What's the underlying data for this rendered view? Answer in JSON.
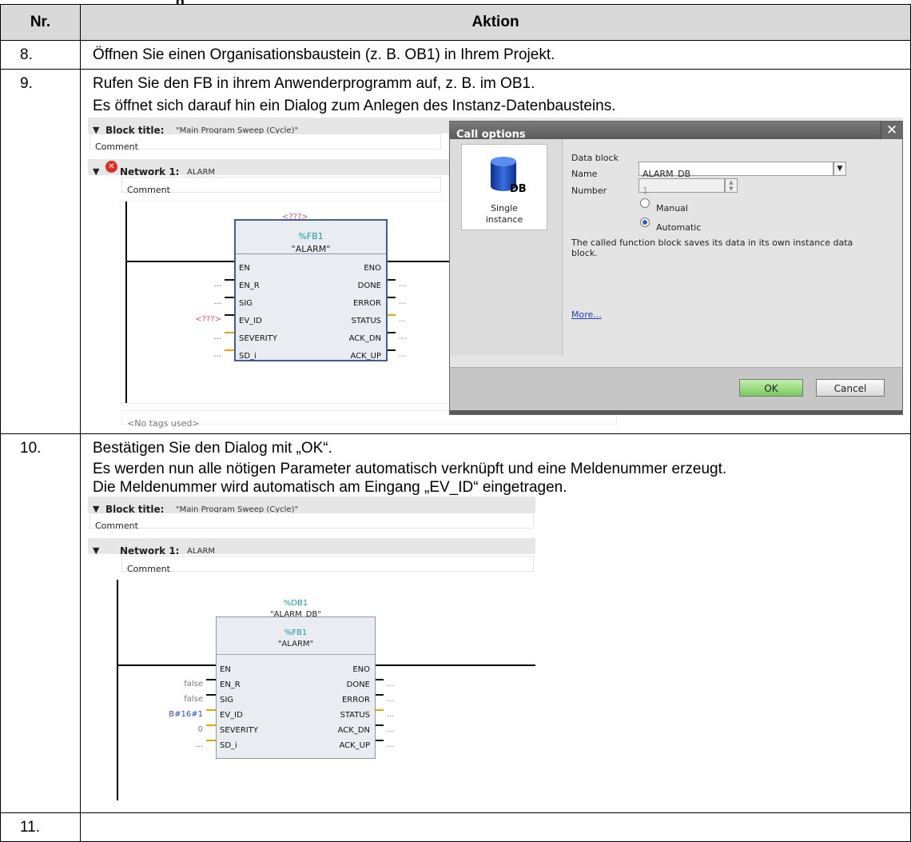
{
  "table": {
    "header_overflow": "g",
    "col_nr": "Nr.",
    "col_action": "Aktion"
  },
  "rows": [
    {
      "nr": "8.",
      "lines": [
        "Öffnen Sie einen Organisationsbaustein (z. B. OB1) in Ihrem Projekt."
      ]
    },
    {
      "nr": "9.",
      "lines": [
        "Rufen Sie den FB in ihrem Anwenderprogramm auf, z. B. im OB1.",
        "Es öffnet sich darauf hin ein Dialog zum Anlegen des Instanz-Datenbausteins."
      ]
    },
    {
      "nr": "10.",
      "lines": [
        "Bestätigen Sie den Dialog mit „OK“.",
        "Es werden nun alle nötigen Parameter automatisch verknüpft und eine Meldenummer erzeugt.",
        "Die Meldenummer wird automatisch am Eingang „EV_ID“ eingetragen."
      ]
    },
    {
      "nr": "11.",
      "lines": []
    }
  ],
  "shot1": {
    "block_title_label": "Block title:",
    "block_title_value": "\"Main Program Sweep (Cycle)\"",
    "comment": "Comment",
    "network_label": "Network 1:",
    "network_name": "ALARM",
    "network_comment": "Comment",
    "instance_placeholder": "<???>",
    "fb_address": "%FB1",
    "fb_name": "\"ALARM\"",
    "inputs": [
      "EN",
      "EN_R",
      "SIG",
      "EV_ID",
      "SEVERITY",
      "SD_i"
    ],
    "outputs": [
      "ENO",
      "DONE",
      "ERROR",
      "STATUS",
      "ACK_DN",
      "ACK_UP"
    ],
    "input_values": [
      "",
      "...",
      "...",
      "<???>",
      "...",
      "..."
    ],
    "output_values": [
      "",
      "...",
      "...",
      "...",
      "...",
      "..."
    ],
    "no_tags": "<No tags used>"
  },
  "dialog": {
    "title": "Call options",
    "close": "✕",
    "instance_label_1": "Single",
    "instance_label_2": "instance",
    "db_badge": "DB",
    "section": "Data block",
    "name_label": "Name",
    "name_value": "ALARM_DB",
    "number_label": "Number",
    "number_value": "1",
    "manual": "Manual",
    "automatic": "Automatic",
    "description": "The called function block saves its data in its own instance data block.",
    "more": "More...",
    "ok": "OK",
    "cancel": "Cancel"
  },
  "shot2": {
    "block_title_label": "Block title:",
    "block_title_value": "\"Main Program Sweep (Cycle)\"",
    "comment": "Comment",
    "network_label": "Network 1:",
    "network_name": "ALARM",
    "network_comment": "Comment",
    "db_address": "%DB1",
    "db_name": "\"ALARM_DB\"",
    "fb_address": "%FB1",
    "fb_name": "\"ALARM\"",
    "inputs": [
      "EN",
      "EN_R",
      "SIG",
      "EV_ID",
      "SEVERITY",
      "SD_i"
    ],
    "outputs": [
      "ENO",
      "DONE",
      "ERROR",
      "STATUS",
      "ACK_DN",
      "ACK_UP"
    ],
    "input_values": [
      "",
      "false",
      "false",
      "B#16#1",
      "0",
      "..."
    ],
    "output_values": [
      "",
      "...",
      "...",
      "...",
      "...",
      "..."
    ]
  },
  "colors": {
    "header_bg": "#d9d9d9",
    "dialog_title": "#5a5a5a",
    "ok_green": "#78c95c",
    "link_blue": "#1f3fbf",
    "placeholder_red": "#e8506b",
    "address_teal": "#1a9aa6",
    "value_blue": "#2b50c8"
  },
  "icons": [
    "expand-triangle-icon",
    "error-icon",
    "database-cylinder-icon",
    "close-icon",
    "dropdown-arrow-icon",
    "spinner-icon"
  ]
}
